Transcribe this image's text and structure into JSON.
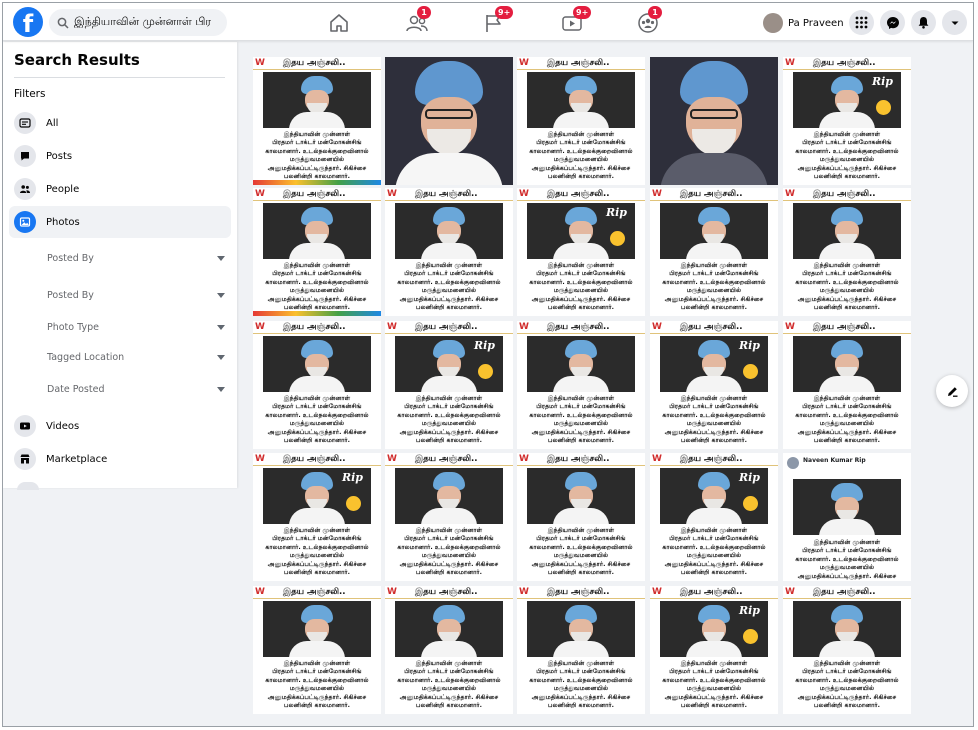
{
  "search": {
    "value": "இந்தியாவின் முன்னாள் பிர"
  },
  "nav": {
    "friends_badge": "1",
    "pages_badge": "9+",
    "watch_badge": "9+",
    "groups_badge": "1"
  },
  "profile": {
    "name": "Pa Praveen"
  },
  "sidebar": {
    "title": "Search Results",
    "filters_label": "Filters",
    "items": [
      {
        "label": "All",
        "icon": "all-results-icon"
      },
      {
        "label": "Posts",
        "icon": "posts-icon"
      },
      {
        "label": "People",
        "icon": "people-icon"
      },
      {
        "label": "Photos",
        "icon": "photos-icon",
        "active": true
      },
      {
        "label": "Videos",
        "icon": "videos-icon"
      },
      {
        "label": "Marketplace",
        "icon": "marketplace-icon"
      }
    ],
    "sub_filters": [
      "Posted By",
      "Posted By",
      "Photo Type",
      "Tagged Location",
      "Date Posted"
    ]
  },
  "photos": {
    "title_text": "இதய அஞ்சலி..",
    "caption_text": "இந்தியாவின் முன்னாள்\nபிரதமர் டாக்டர் மன்மோகன்சிங்\nகாலமானார். உடல்நலக்குறைவினால்\nமருத்துவமனையில்\nஅனுமதிக்கப்பட்டிருந்தார். சிகிச்சை\nபலனின்றி காலமானார்.",
    "rip_text": "Rip",
    "post_author": "Naveen Kumar Rip",
    "logo_text": "W"
  },
  "colors": {
    "brand": "#1877f2",
    "badge": "#e41e3f",
    "page_bg": "#f0f2f5"
  }
}
